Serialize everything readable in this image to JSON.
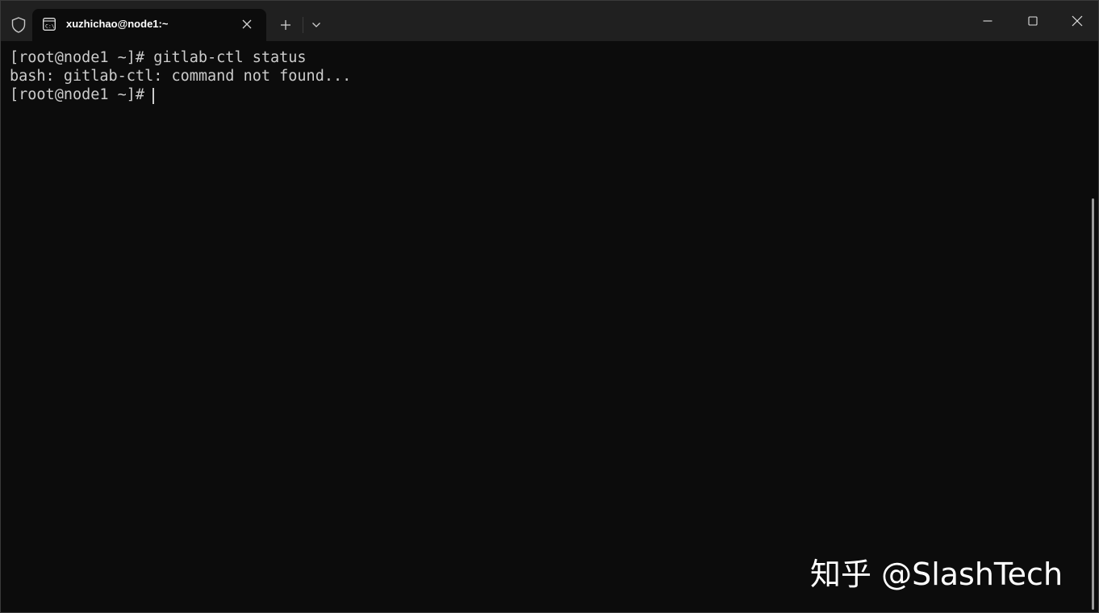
{
  "tab": {
    "title": "xuzhichao@node1:~",
    "icon": "terminal-icon"
  },
  "titlebar": {
    "shield_icon": "shield-icon",
    "new_tab": "+",
    "dropdown_icon": "chevron-down-icon",
    "minimize_icon": "minimize-icon",
    "maximize_icon": "maximize-icon",
    "close_icon": "close-icon"
  },
  "terminal": {
    "lines": [
      "[root@node1 ~]# gitlab-ctl status",
      "bash: gitlab-ctl: command not found...",
      "[root@node1 ~]# "
    ]
  },
  "watermark": "知乎 @SlashTech",
  "colors": {
    "titlebar_bg": "#202020",
    "terminal_bg": "#0c0c0c",
    "terminal_text": "#cccccc"
  }
}
